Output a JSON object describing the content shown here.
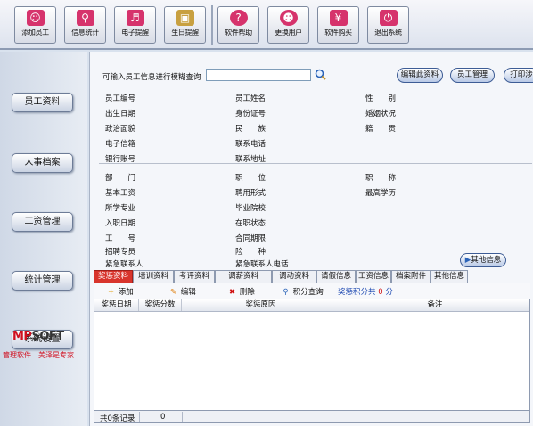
{
  "toolbar": {
    "buttons": [
      {
        "label": "添加员工",
        "icon": "person-add-icon",
        "color": "#d6336c"
      },
      {
        "label": "信息统计",
        "icon": "magnifier-stats-icon",
        "color": "#d6336c"
      },
      {
        "label": "电子提醒",
        "icon": "speaker-icon",
        "color": "#d6336c"
      },
      {
        "label": "生日提醒",
        "icon": "birthday-calendar-icon",
        "color": "#c8a040"
      },
      {
        "label": "软件帮助",
        "icon": "help-icon",
        "color": "#d6336c"
      },
      {
        "label": "更换用户",
        "icon": "switch-user-icon",
        "color": "#d6336c"
      },
      {
        "label": "软件购买",
        "icon": "yen-purchase-icon",
        "color": "#d6336c"
      },
      {
        "label": "退出系统",
        "icon": "power-icon",
        "color": "#d6336c"
      }
    ]
  },
  "sidebar": {
    "items": [
      {
        "label": "员工资料"
      },
      {
        "label": "人事档案"
      },
      {
        "label": "工资管理"
      },
      {
        "label": "统计管理"
      },
      {
        "label": "系统设置"
      }
    ],
    "logo": {
      "part1": "MP",
      "part2": "SOFT"
    },
    "slogan": "管理软件　美泽是专家"
  },
  "search": {
    "label": "可输入员工信息进行模糊查询",
    "placeholder": ""
  },
  "actions": {
    "edit_label": "编辑此资料",
    "manage_label": "员工管理",
    "print_label": "打印涉"
  },
  "fields": {
    "col1": [
      "员工编号",
      "出生日期",
      "政治面貌",
      "电子信箱",
      "银行账号"
    ],
    "col2": [
      "员工姓名",
      "身份证号",
      "民　　族",
      "联系电话",
      "联系地址"
    ],
    "col3": [
      "性　　别",
      "婚姻状况",
      "籍　　贯"
    ],
    "col1b": [
      "部　　门",
      "基本工资",
      "所学专业",
      "入职日期",
      "工　　号",
      "招聘专员",
      "紧急联系人"
    ],
    "col2b": [
      "职　　位",
      "聘用形式",
      "毕业院校",
      "在职状态",
      "合同期限",
      "险　　种",
      "紧急联系人电话"
    ],
    "col3b": [
      "职　　称",
      "最高学历"
    ]
  },
  "other_info_label": "其他信息",
  "tabs": [
    "奖惩资料",
    "培训资料",
    "考评资料",
    "调薪资料",
    "调动资料",
    "请假信息",
    "工资信息",
    "档案附件",
    "其他信息"
  ],
  "subtoolbar": {
    "add": "添加",
    "edit": "编辑",
    "delete": "删除",
    "query": "积分查询",
    "total_label": "奖惩积分共",
    "total_value": "0",
    "total_unit": "分"
  },
  "grid": {
    "columns": [
      "奖惩日期",
      "奖惩分数",
      "奖惩原因",
      "备注"
    ],
    "rows": []
  },
  "footer": {
    "records": "共0条记录",
    "value": "0"
  }
}
